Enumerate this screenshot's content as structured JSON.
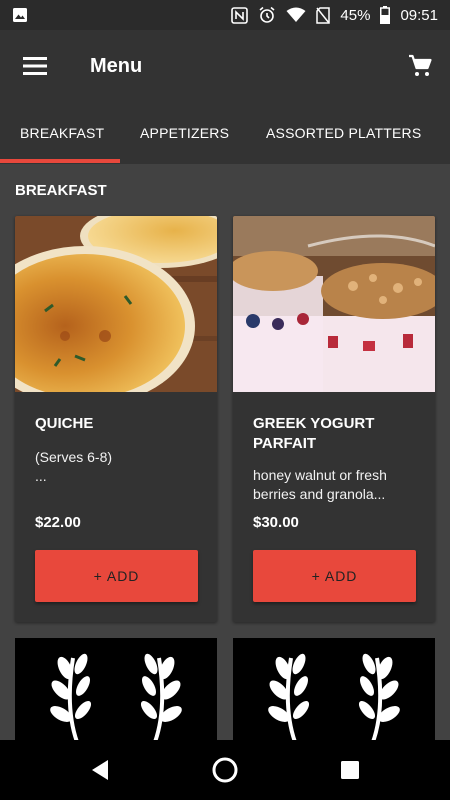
{
  "status": {
    "battery": "45%",
    "time": "09:51"
  },
  "appbar": {
    "title": "Menu"
  },
  "tabs": [
    {
      "label": "BREAKFAST",
      "active": true
    },
    {
      "label": "APPETIZERS",
      "active": false
    },
    {
      "label": "ASSORTED PLATTERS",
      "active": false
    }
  ],
  "section": {
    "title": "BREAKFAST"
  },
  "items": [
    {
      "name": "QUICHE",
      "desc": "(Serves 6-8)\n...",
      "price": "$22.00",
      "add_label": "+ ADD"
    },
    {
      "name": "GREEK YOGURT PARFAIT",
      "desc": "honey walnut or fresh berries and granola...",
      "price": "$30.00",
      "add_label": "+ ADD"
    }
  ],
  "colors": {
    "accent": "#e8483c",
    "surface": "#333333",
    "background": "#424242"
  },
  "icons": [
    "image-icon",
    "nfc-icon",
    "alarm-icon",
    "wifi-icon",
    "no-sim-icon",
    "battery-icon",
    "hamburger-menu-icon",
    "shopping-cart-icon",
    "laurel-icon",
    "back-icon",
    "home-icon",
    "recents-icon"
  ]
}
